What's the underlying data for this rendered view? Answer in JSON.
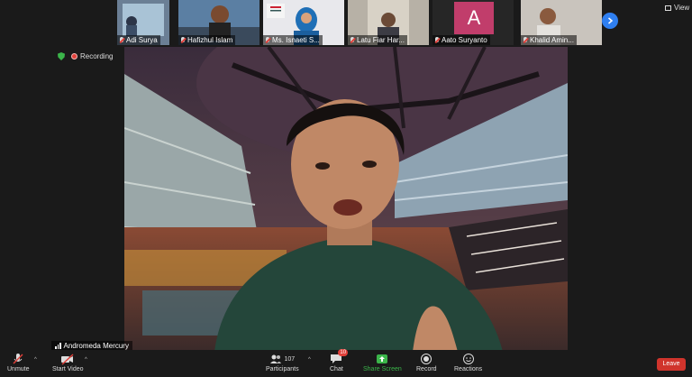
{
  "participants": [
    {
      "name": "Adi Surya",
      "muted": true
    },
    {
      "name": "Hafizhul Islam",
      "muted": true
    },
    {
      "name": "Ms. Isnaeti S...",
      "muted": true
    },
    {
      "name": "Latu Fiar Har...",
      "muted": true
    },
    {
      "name": "Aato Suryanto",
      "muted": true,
      "initial": "A"
    },
    {
      "name": "Khalid Amin...",
      "muted": true
    }
  ],
  "header": {
    "view_label": "View"
  },
  "status": {
    "recording_label": "Recording"
  },
  "speaker": {
    "name": "Andromeda Mercury"
  },
  "toolbar": {
    "unmute_label": "Unmute",
    "start_video_label": "Start Video",
    "participants_label": "Participants",
    "participants_count": "107",
    "chat_label": "Chat",
    "chat_badge": "10",
    "share_label": "Share Screen",
    "record_label": "Record",
    "reactions_label": "Reactions",
    "leave_label": "Leave"
  },
  "colors": {
    "share": "#3bb54a",
    "leave": "#d0342c",
    "accent": "#2f7ff0",
    "avatar_a": "#c13d6b"
  }
}
